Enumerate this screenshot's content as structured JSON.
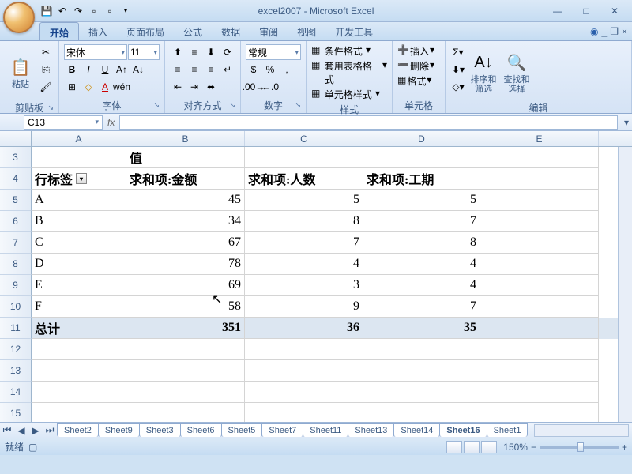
{
  "window": {
    "title": "excel2007 - Microsoft Excel"
  },
  "qat": {
    "save_tip": "保存",
    "undo_tip": "撤销",
    "redo_tip": "恢复"
  },
  "tabs": {
    "home": "开始",
    "insert": "插入",
    "layout": "页面布局",
    "formulas": "公式",
    "data": "数据",
    "review": "审阅",
    "view": "视图",
    "dev": "开发工具"
  },
  "ribbon": {
    "clipboard": {
      "paste": "粘贴",
      "label": "剪贴板"
    },
    "font": {
      "name": "宋体",
      "size": "11",
      "label": "字体"
    },
    "align": {
      "label": "对齐方式"
    },
    "number": {
      "format": "常规",
      "label": "数字"
    },
    "styles": {
      "cond": "条件格式",
      "table": "套用表格格式",
      "cell": "单元格样式",
      "label": "样式"
    },
    "cells": {
      "insert": "插入",
      "delete": "删除",
      "format": "格式",
      "label": "单元格"
    },
    "editing": {
      "sort": "排序和\n筛选",
      "find": "查找和\n选择",
      "label": "编辑"
    }
  },
  "namebox": {
    "ref": "C13"
  },
  "cols": {
    "A": 120,
    "B": 150,
    "C": 150,
    "D": 148,
    "E": 150
  },
  "pivot": {
    "value_header": "值",
    "row_label": "行标签",
    "headers": [
      "求和项:金额",
      "求和项:人数",
      "求和项:工期"
    ],
    "rows": [
      {
        "k": "A",
        "v": [
          45,
          5,
          5
        ]
      },
      {
        "k": "B",
        "v": [
          34,
          8,
          7
        ]
      },
      {
        "k": "C",
        "v": [
          67,
          7,
          8
        ]
      },
      {
        "k": "D",
        "v": [
          78,
          4,
          4
        ]
      },
      {
        "k": "E",
        "v": [
          69,
          3,
          4
        ]
      },
      {
        "k": "F",
        "v": [
          58,
          9,
          7
        ]
      }
    ],
    "total_label": "总计",
    "totals": [
      351,
      36,
      35
    ]
  },
  "row_start": 3,
  "sheets": [
    "Sheet2",
    "Sheet9",
    "Sheet3",
    "Sheet6",
    "Sheet5",
    "Sheet7",
    "Sheet11",
    "Sheet13",
    "Sheet14",
    "Sheet16",
    "Sheet1"
  ],
  "active_sheet": "Sheet16",
  "status": {
    "ready": "就绪",
    "zoom": "150%"
  },
  "chart_data": {
    "type": "table",
    "title": "值",
    "columns": [
      "行标签",
      "求和项:金额",
      "求和项:人数",
      "求和项:工期"
    ],
    "rows": [
      [
        "A",
        45,
        5,
        5
      ],
      [
        "B",
        34,
        8,
        7
      ],
      [
        "C",
        67,
        7,
        8
      ],
      [
        "D",
        78,
        4,
        4
      ],
      [
        "E",
        69,
        3,
        4
      ],
      [
        "F",
        58,
        9,
        7
      ],
      [
        "总计",
        351,
        36,
        35
      ]
    ]
  }
}
